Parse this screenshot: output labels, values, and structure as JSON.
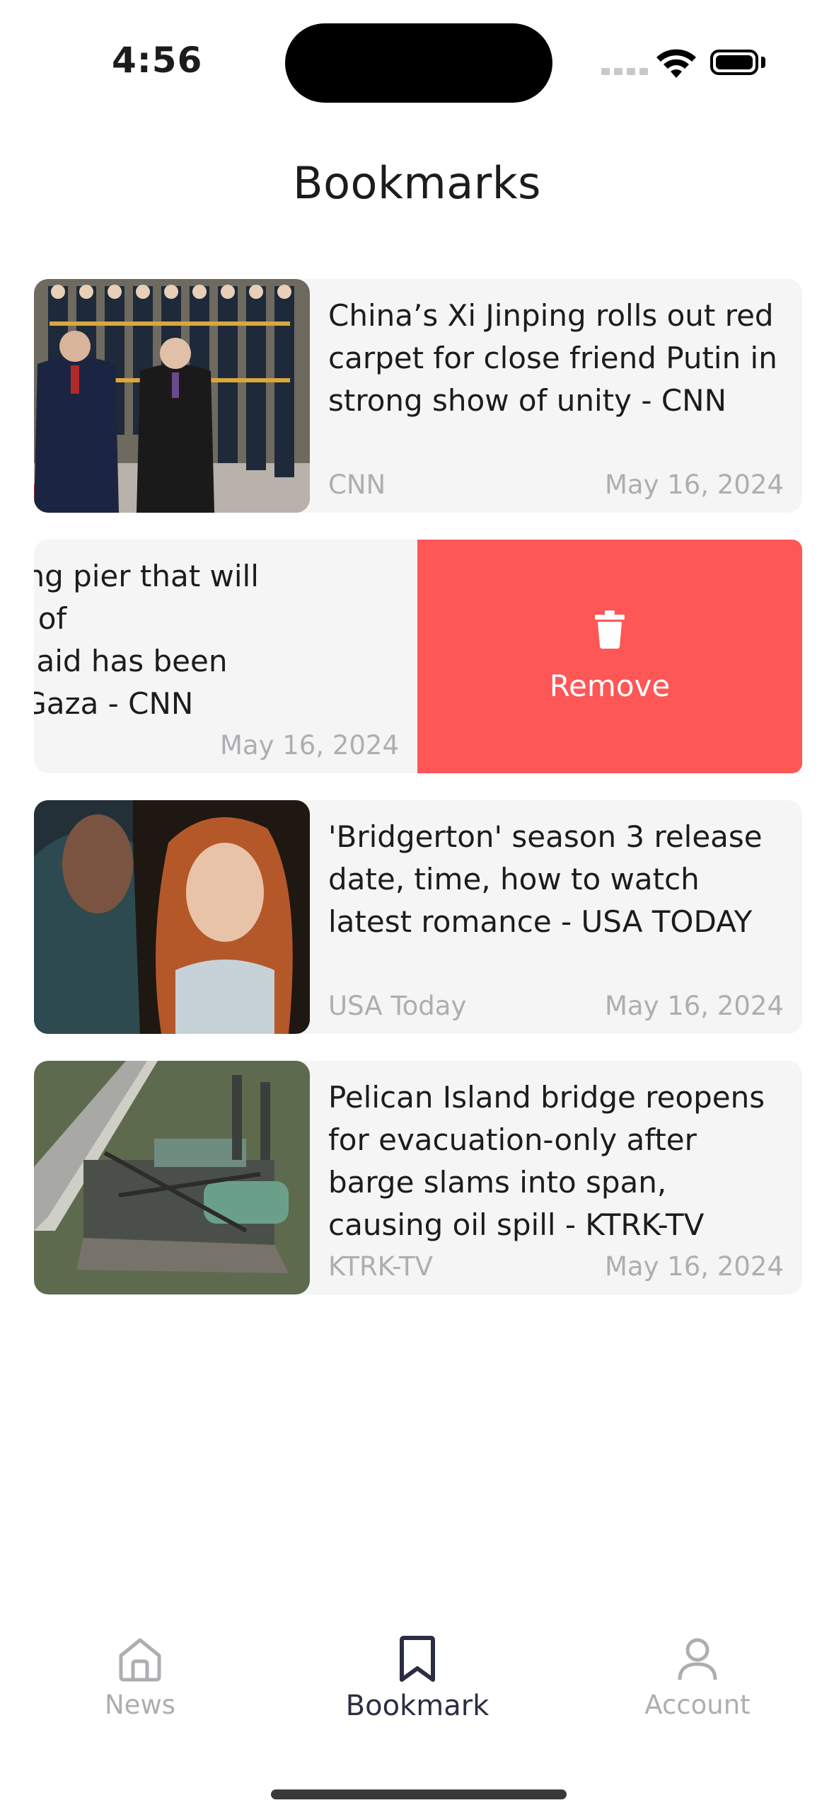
{
  "status_bar": {
    "time": "4:56"
  },
  "header": {
    "title": "Bookmarks"
  },
  "bookmarks": [
    {
      "headline": "China’s Xi Jinping rolls out red carpet for close friend Putin in strong show of unity - CNN",
      "source": "CNN",
      "date": "May 16, 2024"
    },
    {
      "headline_lines": [
        "built floating pier that will",
        "w delivery of",
        "nanitarian aid has been",
        "chored in Gaza - CNN"
      ],
      "date": "May 16, 2024",
      "action_label": "Remove"
    },
    {
      "headline": "'Bridgerton' season 3 release date, time, how to watch latest romance - USA TODAY",
      "source": "USA Today",
      "date": "May 16, 2024"
    },
    {
      "headline": "Pelican Island bridge reopens for evacuation-only after barge slams into span, causing oil spill - KTRK-TV",
      "source": "KTRK-TV",
      "date": "May 16, 2024"
    }
  ],
  "tab_bar": {
    "items": [
      {
        "label": "News",
        "icon": "home-icon"
      },
      {
        "label": "Bookmark",
        "icon": "bookmark-icon",
        "active": true
      },
      {
        "label": "Account",
        "icon": "person-icon"
      }
    ]
  },
  "colors": {
    "remove_red": "#ff5656",
    "card_bg": "#f5f5f5",
    "muted_text": "#aeaeb2",
    "active_tab": "#2b2d42"
  }
}
